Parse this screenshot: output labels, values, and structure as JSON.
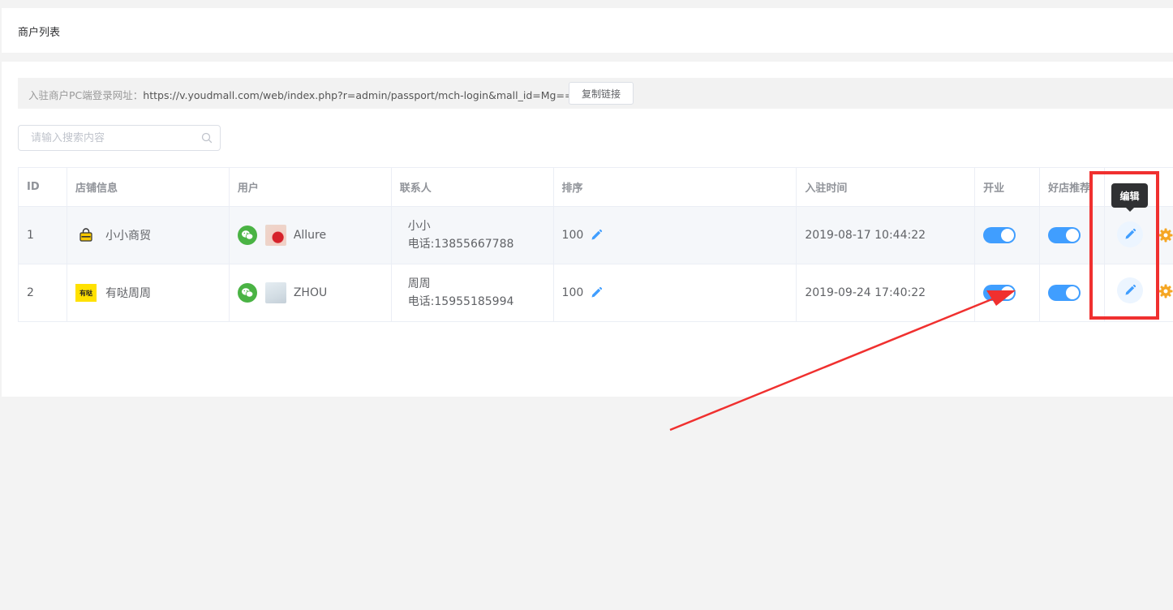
{
  "header": {
    "title": "商户列表"
  },
  "url_bar": {
    "label": "入驻商户PC端登录网址：",
    "url": "https://v.youdmall.com/web/index.php?r=admin/passport/mch-login&mall_id=Mg==",
    "copy_label": "复制链接"
  },
  "search": {
    "placeholder": "请输入搜索内容"
  },
  "table": {
    "columns": [
      "ID",
      "店铺信息",
      "用户",
      "联系人",
      "排序",
      "入驻时间",
      "开业",
      "好店推荐"
    ],
    "rows": [
      {
        "id": "1",
        "shop": "小小商贸",
        "user": "Allure",
        "contact_name": "小小",
        "contact_phone": "电话:13855667788",
        "sort": "100",
        "time": "2019-08-17 10:44:22",
        "open": true,
        "recommend": true
      },
      {
        "id": "2",
        "shop": "有哒周周",
        "shop_logo_text": "有哒",
        "user": "ZHOU",
        "contact_name": "周周",
        "contact_phone": "电话:15955185994",
        "sort": "100",
        "time": "2019-09-24 17:40:22",
        "open": true,
        "recommend": true
      }
    ]
  },
  "tooltip": {
    "text": "编辑"
  },
  "colors": {
    "primary": "#409eff",
    "wechat": "#4ab344",
    "annotation": "#f0302f",
    "gear": "#f5a623"
  }
}
